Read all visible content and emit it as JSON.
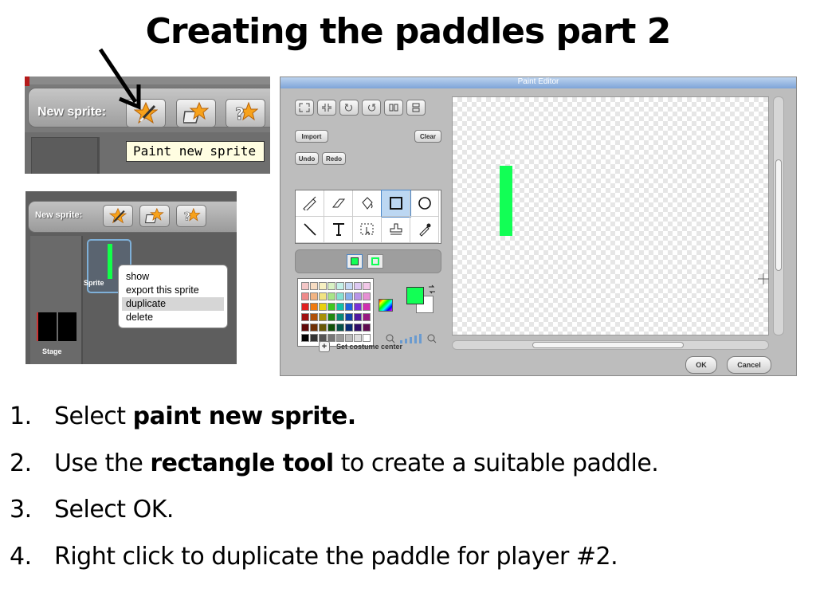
{
  "slide": {
    "title": "Creating the paddles part 2"
  },
  "toolbar_shot": {
    "label": "New sprite:",
    "tooltip": "Paint new sprite",
    "buttons": [
      "paint-star-icon",
      "folder-star-icon",
      "question-star-icon"
    ]
  },
  "context_shot": {
    "label": "New sprite:",
    "sprite_label": "Sprite",
    "stage_label": "Stage",
    "menu_items": [
      "show",
      "export this sprite",
      "duplicate",
      "delete"
    ],
    "selected_item": "duplicate"
  },
  "paint_editor": {
    "title": "Paint Editor",
    "import_label": "Import",
    "clear_label": "Clear",
    "undo_label": "Undo",
    "redo_label": "Redo",
    "tools": [
      "paintbrush-icon",
      "eraser-icon",
      "fill-bucket-icon",
      "rectangle-icon",
      "ellipse-icon",
      "line-icon",
      "text-icon",
      "select-icon",
      "stamp-icon",
      "eyedropper-icon"
    ],
    "active_tool": "rectangle-icon",
    "costume_center_label": "Set costume center",
    "ok_label": "OK",
    "cancel_label": "Cancel",
    "paddle_color": "#12ff55"
  },
  "steps": [
    {
      "num": "1.",
      "pre": "Select ",
      "bold": "paint new sprite.",
      "post": ""
    },
    {
      "num": "2.",
      "pre": "Use the ",
      "bold": "rectangle tool",
      "post": " to create a suitable paddle."
    },
    {
      "num": "3.",
      "pre": "Select OK.",
      "bold": "",
      "post": ""
    },
    {
      "num": "4.",
      "pre": "Right click to duplicate the paddle for player #2.",
      "bold": "",
      "post": ""
    }
  ]
}
